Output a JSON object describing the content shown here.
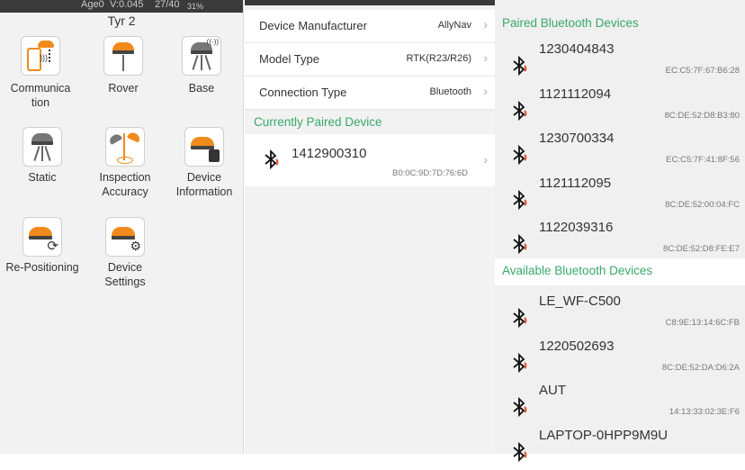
{
  "status_bar": {
    "age": "Age0",
    "version": "V:0.045",
    "sats": "27/40",
    "battery": "31%"
  },
  "device_title": "Tyr 2",
  "tiles": [
    {
      "label": "Communication",
      "icon": "phone-connect-icon"
    },
    {
      "label": "Rover",
      "icon": "rover-receiver-icon"
    },
    {
      "label": "Base",
      "icon": "base-station-icon"
    },
    {
      "label": "Static",
      "icon": "static-receiver-icon"
    },
    {
      "label": "Inspection Accuracy",
      "icon": "inspection-accuracy-icon"
    },
    {
      "label": "Device Information",
      "icon": "device-info-icon"
    },
    {
      "label": "Re-Positioning",
      "icon": "repositioning-icon"
    },
    {
      "label": "Device Settings",
      "icon": "device-settings-icon"
    }
  ],
  "settings": [
    {
      "label": "Device Manufacturer",
      "value": "AllyNav"
    },
    {
      "label": "Model Type",
      "value": "RTK(R23/R26)"
    },
    {
      "label": "Connection Type",
      "value": "Bluetooth"
    }
  ],
  "current_section": "Currently Paired Device",
  "current_device": {
    "name": "1412900310",
    "mac": "B0:0C:9D:7D:76:6D"
  },
  "paired_section": "Paired Bluetooth Devices",
  "paired": [
    {
      "name": "1230404843",
      "mac": "EC:C5:7F:67:B6:28"
    },
    {
      "name": "1121112094",
      "mac": "8C:DE:52:D8:B3:80"
    },
    {
      "name": "1230700334",
      "mac": "EC:C5:7F:41:8F:56"
    },
    {
      "name": "1121112095",
      "mac": "8C:DE:52:00:04:FC"
    },
    {
      "name": "1122039316",
      "mac": "8C:DE:52:D8:FE:E7"
    }
  ],
  "available_section": "Available Bluetooth Devices",
  "available": [
    {
      "name": "LE_WF-C500",
      "mac": "C8:9E:13:14:6C:FB"
    },
    {
      "name": "1220502693",
      "mac": "8C:DE:52:DA:D6:2A"
    },
    {
      "name": "AUT",
      "mac": "14:13:33:02:3E:F6"
    },
    {
      "name": "LAPTOP-0HPP9M9U",
      "mac": ""
    }
  ],
  "colors": {
    "accent": "#3aa86b",
    "brand_orange": "#f08a1c",
    "bluetooth_red": "#e04a2a"
  }
}
